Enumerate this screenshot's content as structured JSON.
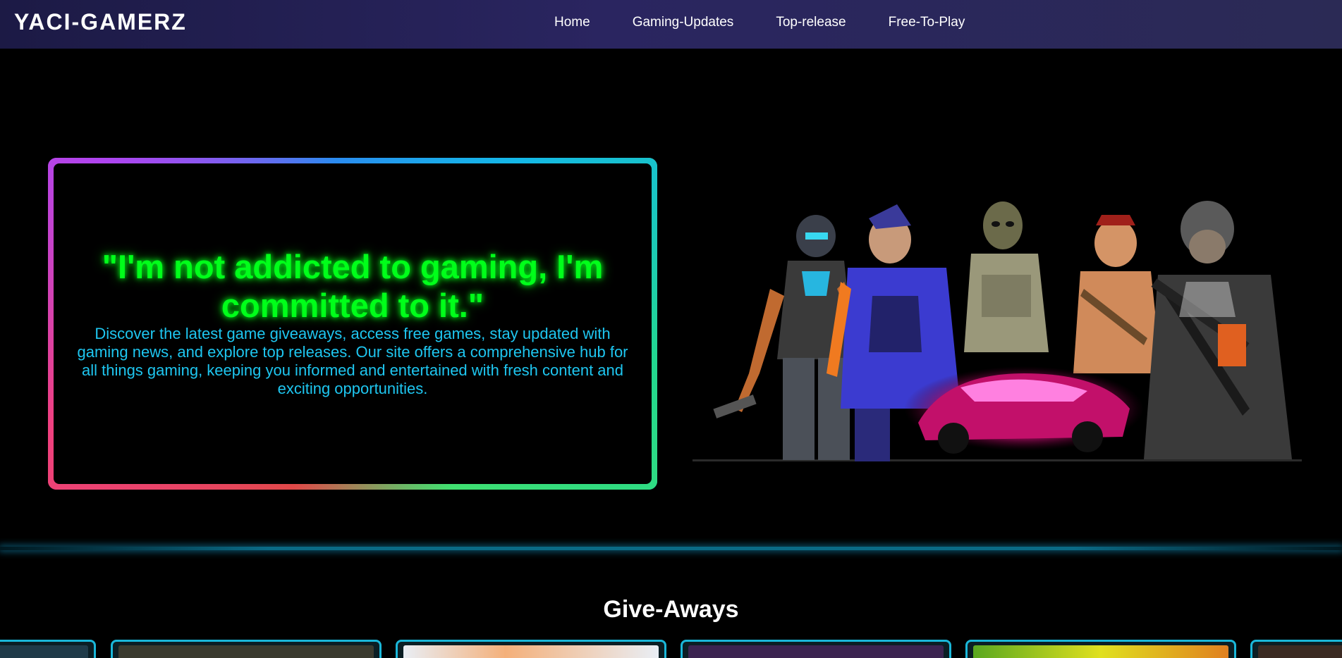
{
  "nav": {
    "brand": "YACI-GAMERZ",
    "links": [
      {
        "label": "Home"
      },
      {
        "label": "Gaming-Updates"
      },
      {
        "label": "Top-release"
      },
      {
        "label": "Free-To-Play"
      }
    ]
  },
  "hero": {
    "quote": "\"I'm not addicted to gaming, I'm committed to it.\"",
    "description": "Discover the latest game giveaways, access free games, stay updated with gaming news, and explore top releases. Our site offers a comprehensive hub for all things gaming, keeping you informed and entertained with fresh content and exciting opportunities."
  },
  "giveaways": {
    "title": "Give-Aways",
    "cards": [
      {
        "thumb_color": "#1f3a48"
      },
      {
        "thumb_color": "#3a3a2e"
      },
      {
        "thumb_color": "#e9eef5"
      },
      {
        "thumb_color": "#3b2350"
      },
      {
        "thumb_color": "#5aa820"
      },
      {
        "thumb_color": "#3b2a22"
      }
    ]
  },
  "colors": {
    "quote": "#00ff1a",
    "description": "#1ec6f0",
    "card_border": "#1ab7d9",
    "nav_bg": "#2a2560"
  }
}
